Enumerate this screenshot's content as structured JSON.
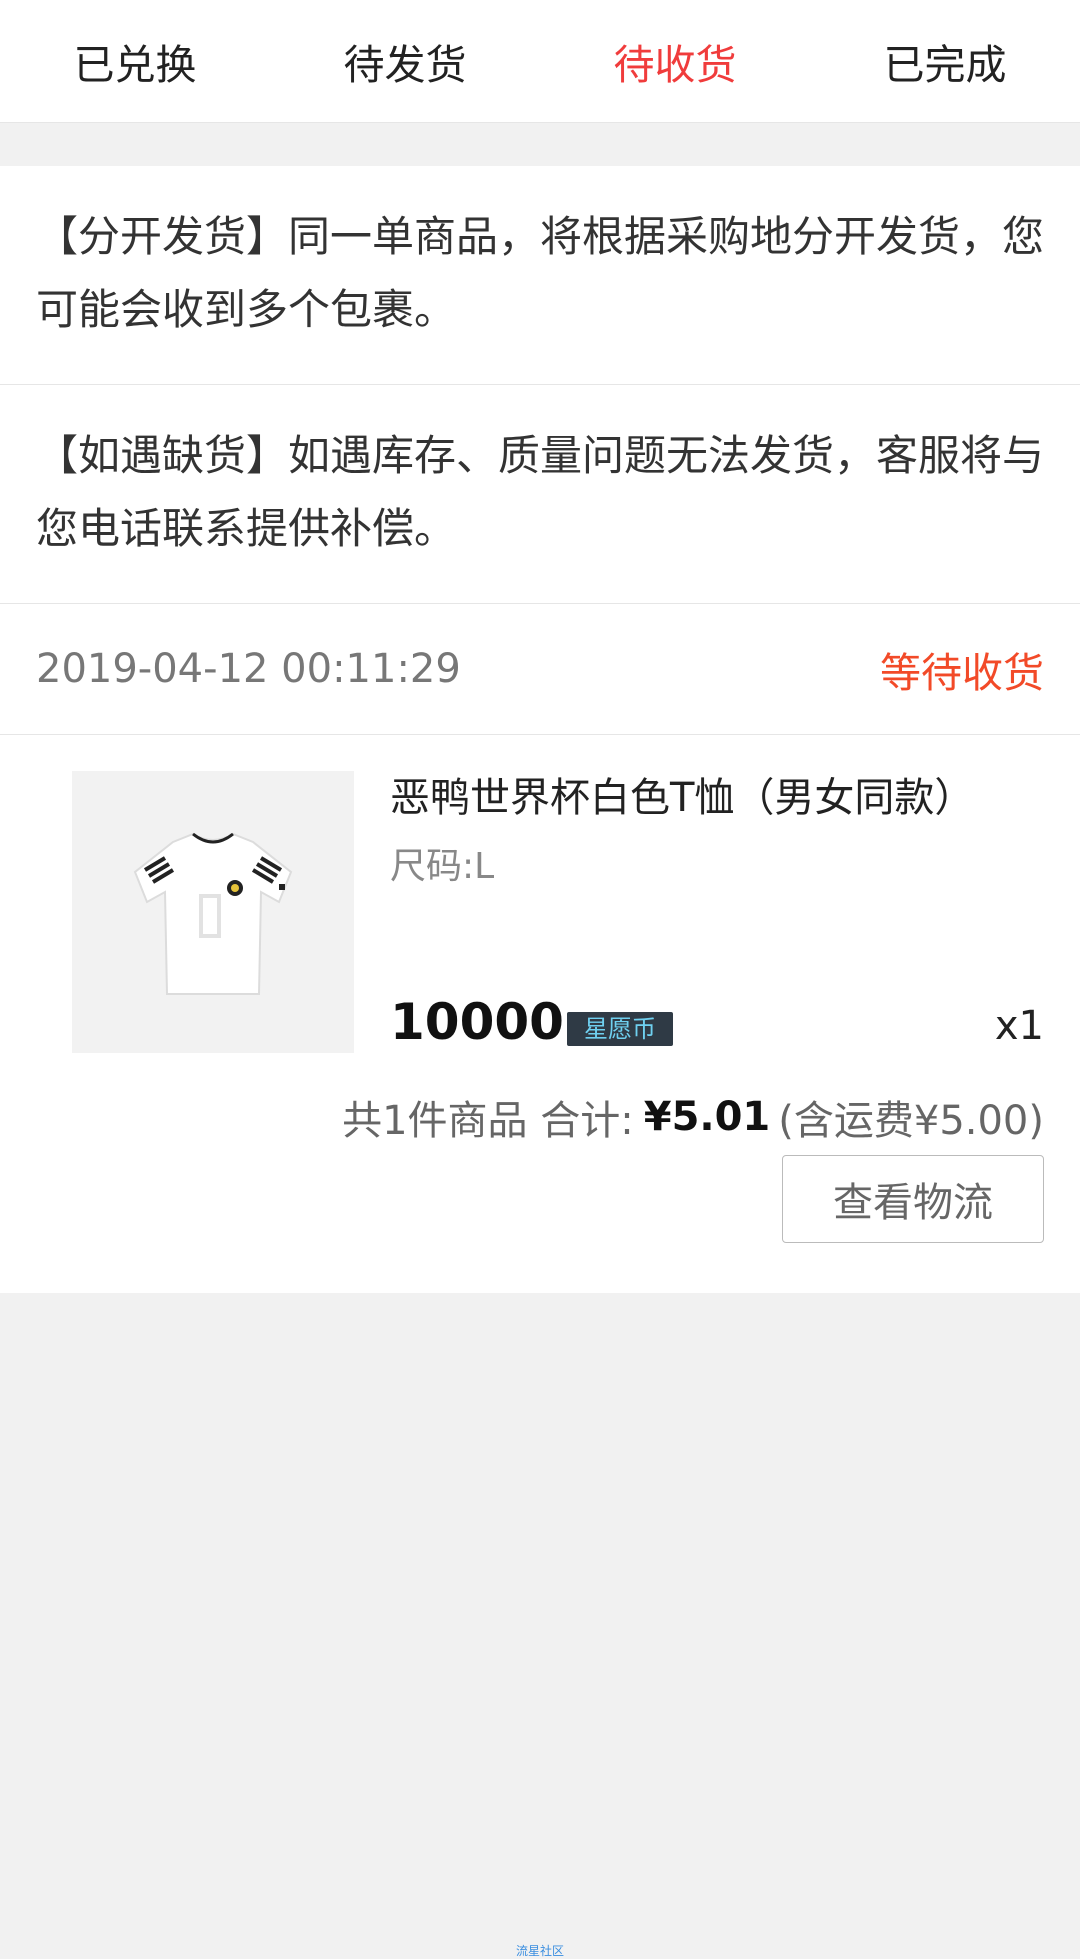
{
  "tabs": [
    {
      "label": "已兑换",
      "active": false
    },
    {
      "label": "待发货",
      "active": false
    },
    {
      "label": "待收货",
      "active": true
    },
    {
      "label": "已完成",
      "active": false
    }
  ],
  "notices": [
    "【分开发货】同一单商品，将根据采购地分开发货，您可能会收到多个包裹。",
    "【如遇缺货】如遇库存、质量问题无法发货，客服将与您电话联系提供补偿。"
  ],
  "order": {
    "time": "2019-04-12 00:11:29",
    "status": "等待收货",
    "item": {
      "name": "恶鸭世界杯白色T恤（男女同款）",
      "size": "尺码:L",
      "price": "10000",
      "currency": "星愿币",
      "quantity": "x1",
      "image": "white-tshirt"
    },
    "summary": {
      "count": "共1件商品 合计:",
      "total": "¥5.01",
      "shipping": "(含运费¥5.00)"
    },
    "action_label": "查看物流"
  },
  "watermark": "流星社区",
  "colors": {
    "active_tab": "#f03c3c",
    "status": "#f24a28",
    "badge_bg": "#2f3a45",
    "badge_text": "#6fd0f0"
  }
}
